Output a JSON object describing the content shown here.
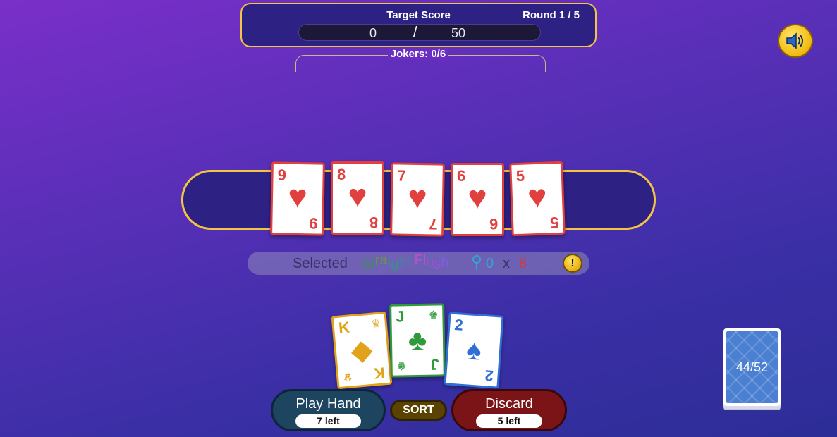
{
  "score_panel": {
    "title": "Target Score",
    "round": "Round 1 / 5",
    "current": "0",
    "separator": "/",
    "target": "50"
  },
  "jokers": {
    "label": "Jokers: 0/6"
  },
  "sound": {
    "icon": "speaker-icon"
  },
  "played_cards": [
    {
      "rank": "9",
      "suit": "♥"
    },
    {
      "rank": "8",
      "suit": "♥"
    },
    {
      "rank": "7",
      "suit": "♥"
    },
    {
      "rank": "6",
      "suit": "♥"
    },
    {
      "rank": "5",
      "suit": "♥"
    }
  ],
  "selection": {
    "label": "Selected",
    "hand_name": "Straight Flush",
    "chips": "0",
    "times": "x",
    "mult": "8",
    "info_icon": "!"
  },
  "hand_cards": [
    {
      "rank": "K",
      "center": "◆",
      "mini_top": "♛",
      "mini_bottom": "♛",
      "color": "#e2a31c",
      "border": "#e2a31c"
    },
    {
      "rank": "J",
      "center": "♣",
      "mini_top": "♚",
      "mini_bottom": "♚",
      "color": "#2e9a3a",
      "border": "#2e9a3a"
    },
    {
      "rank": "2",
      "center": "♠",
      "mini_top": "",
      "mini_bottom": "",
      "color": "#2f6fd6",
      "border": "#2f6fd6"
    }
  ],
  "buttons": {
    "play": {
      "label": "Play Hand",
      "sub": "7 left"
    },
    "sort": {
      "label": "SORT"
    },
    "discard": {
      "label": "Discard",
      "sub": "5 left"
    }
  },
  "deck": {
    "count": "44/52"
  },
  "colors": {
    "gold": "#f3c544",
    "panel": "#2e2184",
    "heart_red": "#e2403e"
  }
}
